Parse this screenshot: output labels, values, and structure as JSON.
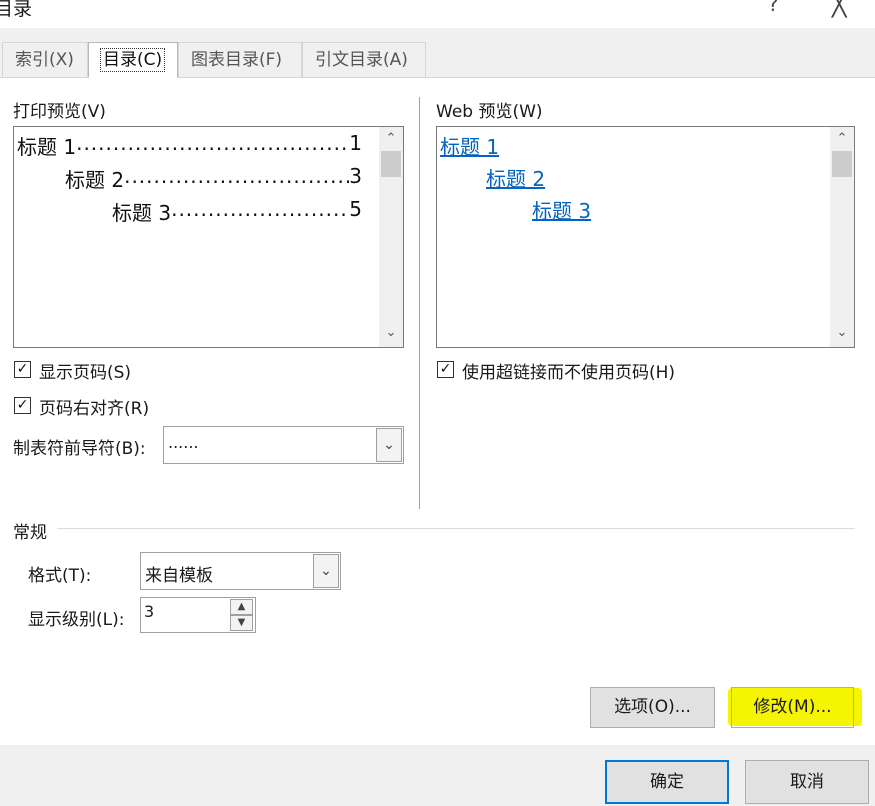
{
  "window": {
    "title": "目录",
    "help_glyph": "?",
    "close_glyph": "╳"
  },
  "tabs": [
    {
      "label": "索引(X)",
      "active": false
    },
    {
      "label": "目录(C)",
      "active": true
    },
    {
      "label": "图表目录(F)",
      "active": false
    },
    {
      "label": "引文目录(A)",
      "active": false
    }
  ],
  "print_preview": {
    "label": "打印预览(V)",
    "lines": [
      {
        "heading": "标题 1",
        "page": "1"
      },
      {
        "heading": "标题 2",
        "page": "3"
      },
      {
        "heading": "标题 3",
        "page": "5"
      }
    ]
  },
  "web_preview": {
    "label": "Web 预览(W)",
    "links": [
      "标题 1",
      "标题 2",
      "标题 3"
    ]
  },
  "show_page_numbers": {
    "label": "显示页码(S)",
    "checked": true
  },
  "right_align_page_numbers": {
    "label": "页码右对齐(R)",
    "checked": true
  },
  "tab_leader": {
    "label": "制表符前导符(B):",
    "value": "......"
  },
  "use_hyperlinks": {
    "label": "使用超链接而不使用页码(H)",
    "checked": true
  },
  "general": {
    "section_label": "常规",
    "formats_label": "格式(T):",
    "formats_value": "来自模板",
    "show_levels_label": "显示级别(L):",
    "show_levels_value": "3"
  },
  "buttons": {
    "options": "选项(O)...",
    "modify": "修改(M)...",
    "ok": "确定",
    "cancel": "取消"
  },
  "highlight_color": "#f5f500",
  "accent_color": "#0078d7",
  "link_color": "#0563c1"
}
